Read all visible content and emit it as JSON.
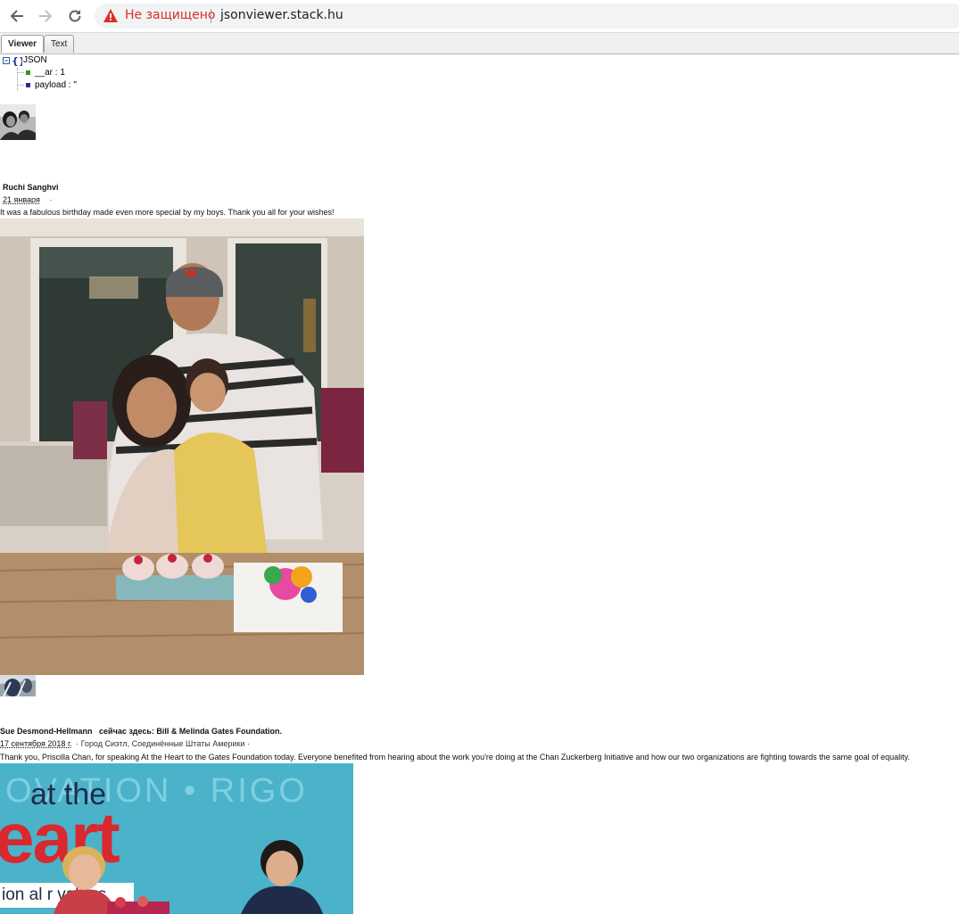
{
  "browser": {
    "security_label": "Не защищено",
    "url": "jsonviewer.stack.hu"
  },
  "viewer_tabs": [
    "Viewer",
    "Text"
  ],
  "tree": {
    "root_label": "JSON",
    "children": [
      "__ar : 1",
      "payload : \""
    ]
  },
  "posts": [
    {
      "author": "Ruchi Sanghvi",
      "date": "21 января",
      "sep": "·",
      "location": "",
      "text": "It was a fabulous birthday made even more special by my boys. Thank you all for your wishes!"
    },
    {
      "author": "Sue Desmond-Hellmann",
      "checkin": "сейчас здесь: Bill & Melinda Gates Foundation.",
      "date": "17 сентября 2018 г.",
      "sep": "·",
      "location": "· Город Сиэтл, Соединённые Штаты Америки ·",
      "text": "Thank you, Priscilla Chan, for speaking At the Heart to the Gates Foundation today. Everyone benefited from hearing about the work you're doing at the Chan Zuckerberg Initiative and how our two organizations are fighting towards the same goal of equality.",
      "photo_text": {
        "line1": "at the",
        "line2": "eart",
        "line3": "ion al  r values",
        "bg_words": "OVATION • RIGO"
      }
    }
  ],
  "colors": {
    "warning_red": "#d93025",
    "photo2_bg": "#4bb3c9",
    "heart_red": "#d9282f"
  }
}
